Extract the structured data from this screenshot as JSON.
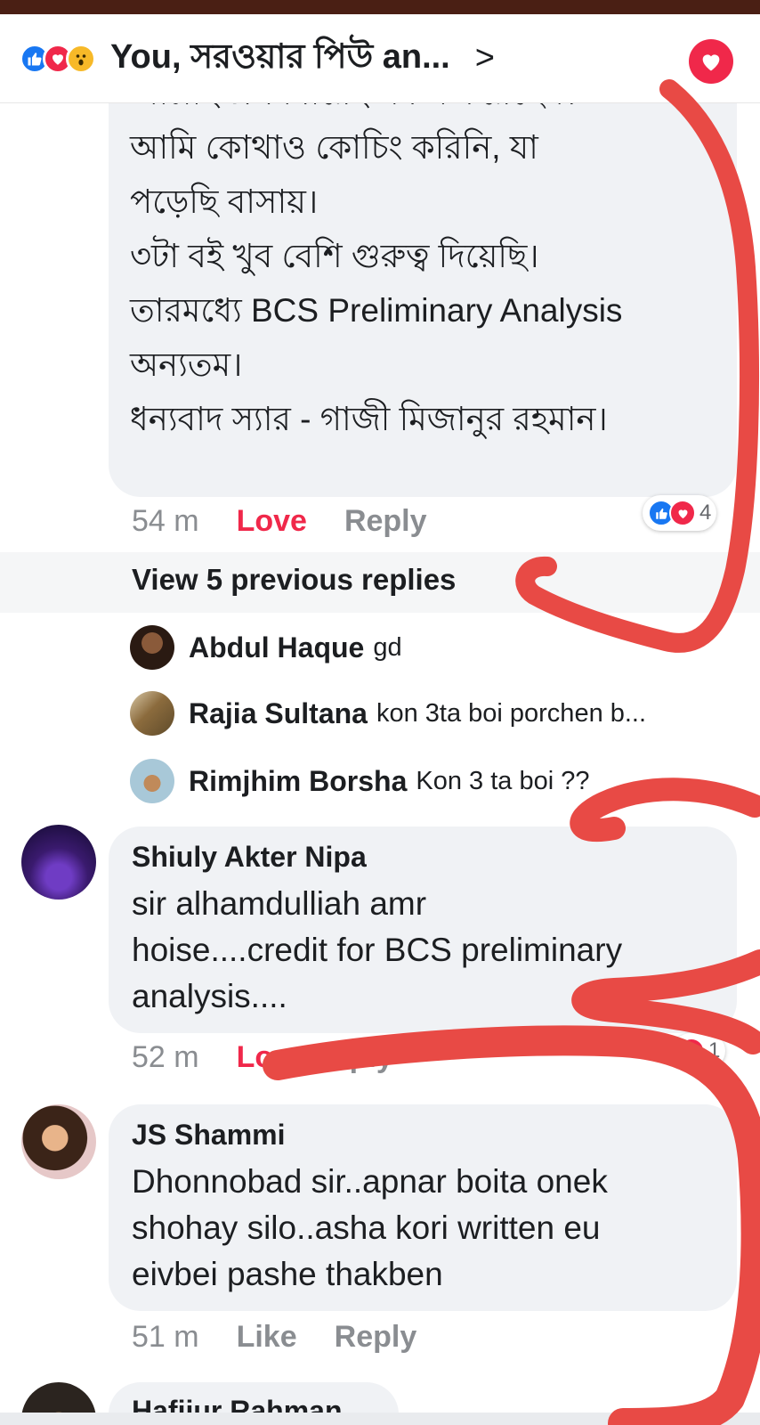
{
  "header": {
    "title": "You, সরওয়ার পিউ an...",
    "reactions": [
      "like-icon",
      "love-icon",
      "wow-icon"
    ]
  },
  "post": {
    "lines": [
      "আল্লাহ প্রথমবারেই সফল করেছেন।",
      "আমি কোথাও কোচিং করিনি, যা",
      "পড়েছি বাসায়।",
      "৩টা বই খুব বেশি গুরুত্ব দিয়েছি।",
      "তারমধ্যে BCS Preliminary Analysis",
      "অন্যতম।",
      "ধন্যবাদ স্যার - গাজী মিজানুর রহমান।"
    ],
    "time": "54 m",
    "love_label": "Love",
    "reply_label": "Reply",
    "reaction_count": "4"
  },
  "view_previous": "View 5 previous replies",
  "replies": [
    {
      "name": "Abdul Haque",
      "text": "gd"
    },
    {
      "name": "Rajia Sultana",
      "text": "kon 3ta boi porchen b..."
    },
    {
      "name": "Rimjhim Borsha",
      "text": "Kon 3 ta boi ??"
    }
  ],
  "comments": [
    {
      "name": "Shiuly Akter Nipa",
      "lines": [
        "sir alhamdulliah  amr",
        "hoise....credit for BCS preliminary",
        "analysis...."
      ],
      "time": "52 m",
      "action1": "Lo",
      "action2": "Reply",
      "reaction_count": "1"
    },
    {
      "name": "JS Shammi",
      "lines": [
        "Dhonnobad sir..apnar boita onek",
        "shohay silo..asha kori written eu",
        "eivbei pashe thakben"
      ],
      "time": "51 m",
      "action1": "Like",
      "action2": "Reply"
    },
    {
      "name": "Hafijur Rahman"
    }
  ],
  "colors": {
    "like": "#1877f2",
    "love": "#f0284a",
    "bubble": "#f0f2f5",
    "scribble": "#e84a45"
  }
}
